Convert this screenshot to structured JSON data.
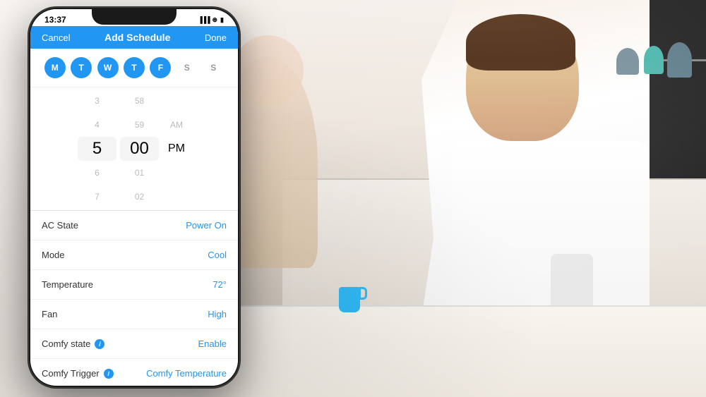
{
  "background": {
    "description": "Kitchen scene with man holding phone"
  },
  "phone": {
    "status_bar": {
      "time": "13:37",
      "signal": "●●●",
      "wifi": "wifi",
      "battery": "■"
    },
    "nav": {
      "cancel": "Cancel",
      "title": "Add Schedule",
      "done": "Done"
    },
    "days": [
      {
        "letter": "M",
        "active": true
      },
      {
        "letter": "T",
        "active": true
      },
      {
        "letter": "W",
        "active": true
      },
      {
        "letter": "T",
        "active": true
      },
      {
        "letter": "F",
        "active": true
      },
      {
        "letter": "S",
        "active": false
      },
      {
        "letter": "S",
        "active": false
      }
    ],
    "time_picker": {
      "hours": [
        "3",
        "4",
        "5",
        "6",
        "7"
      ],
      "minutes": [
        "58",
        "59",
        "00",
        "01",
        "02"
      ],
      "period": [
        "AM",
        "PM"
      ],
      "selected_hour": "5",
      "selected_minute": "00",
      "selected_period": "PM"
    },
    "settings": [
      {
        "label": "AC State",
        "value": "Power On",
        "has_info": false
      },
      {
        "label": "Mode",
        "value": "Cool",
        "has_info": false
      },
      {
        "label": "Temperature",
        "value": "72°",
        "has_info": false
      },
      {
        "label": "Fan",
        "value": "High",
        "has_info": false
      },
      {
        "label": "Comfy state",
        "value": "Enable",
        "has_info": true
      },
      {
        "label": "Comfy Trigger",
        "value": "Comfy Temperature",
        "has_info": true
      }
    ]
  },
  "colors": {
    "brand_blue": "#2196f3",
    "text_dark": "#333333",
    "text_light": "#999999",
    "bg_white": "#ffffff",
    "selected_bg": "#f0f0f0"
  }
}
